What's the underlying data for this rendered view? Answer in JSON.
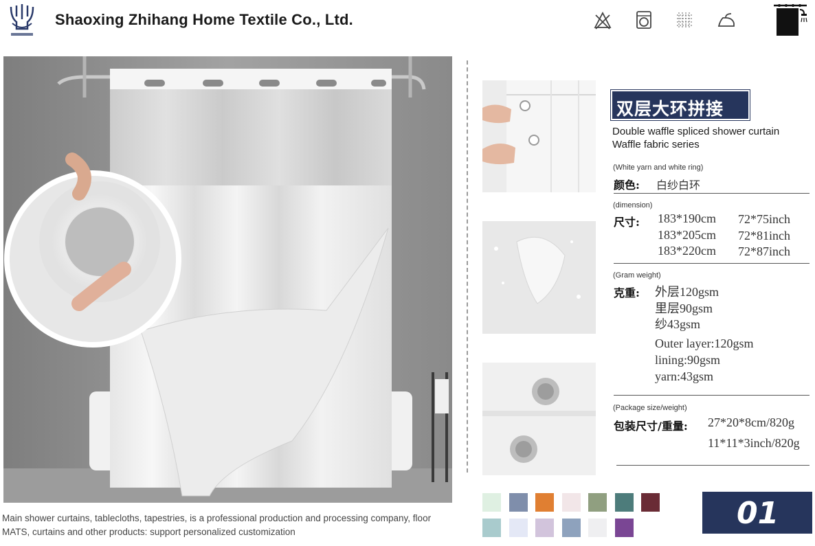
{
  "header": {
    "company": "Shaoxing Zhihang Home Textile Co., Ltd.",
    "care_icons": [
      "no-bleach-icon",
      "machine-wash-icon",
      "tumble-dry-icon",
      "iron-icon"
    ],
    "brand_icon": "shower-curtain-icon"
  },
  "footer": {
    "description": "Main shower curtains, tablecloths, tapestries, is a professional production and processing company, floor MATS, curtains and other products: support personalized customization"
  },
  "product": {
    "title_zh": "双层大环拼接",
    "subtitle_en_1": "Double waffle spliced shower curtain",
    "subtitle_en_2": "Waffle fabric series"
  },
  "specs": {
    "color": {
      "label_en": "(White yarn and white ring)",
      "label_zh": "颜色:",
      "value": "白纱白环"
    },
    "dimension": {
      "label_en": "(dimension)",
      "label_zh": "尺寸:",
      "cm": [
        "183*190cm",
        "183*205cm",
        "183*220cm"
      ],
      "inch": [
        "72*75inch",
        "72*81inch",
        "72*87inch"
      ]
    },
    "gram": {
      "label_en": "(Gram weight)",
      "label_zh": "克重:",
      "values_zh": [
        "外层120gsm",
        "里层90gsm",
        "纱43gsm"
      ],
      "values_en": [
        "Outer layer:120gsm",
        "lining:90gsm",
        "yarn:43gsm"
      ]
    },
    "package": {
      "label_en": "(Package size/weight)",
      "label_zh": "包装尺寸/重量:",
      "values": [
        "27*20*8cm/820g",
        "11*11*3inch/820g"
      ]
    }
  },
  "swatches": {
    "row1": [
      "#dff0e2",
      "#7f8eab",
      "#e07f32",
      "#f2e6e8",
      "#909f80",
      "#4d7c7b",
      "#6a2b35"
    ],
    "row2": [
      "#a9cbcd",
      "#e4e8f6",
      "#d2c4dc",
      "#8ea2bd",
      "#efeff1",
      "#7a4694"
    ]
  },
  "badge": {
    "number": "01"
  }
}
